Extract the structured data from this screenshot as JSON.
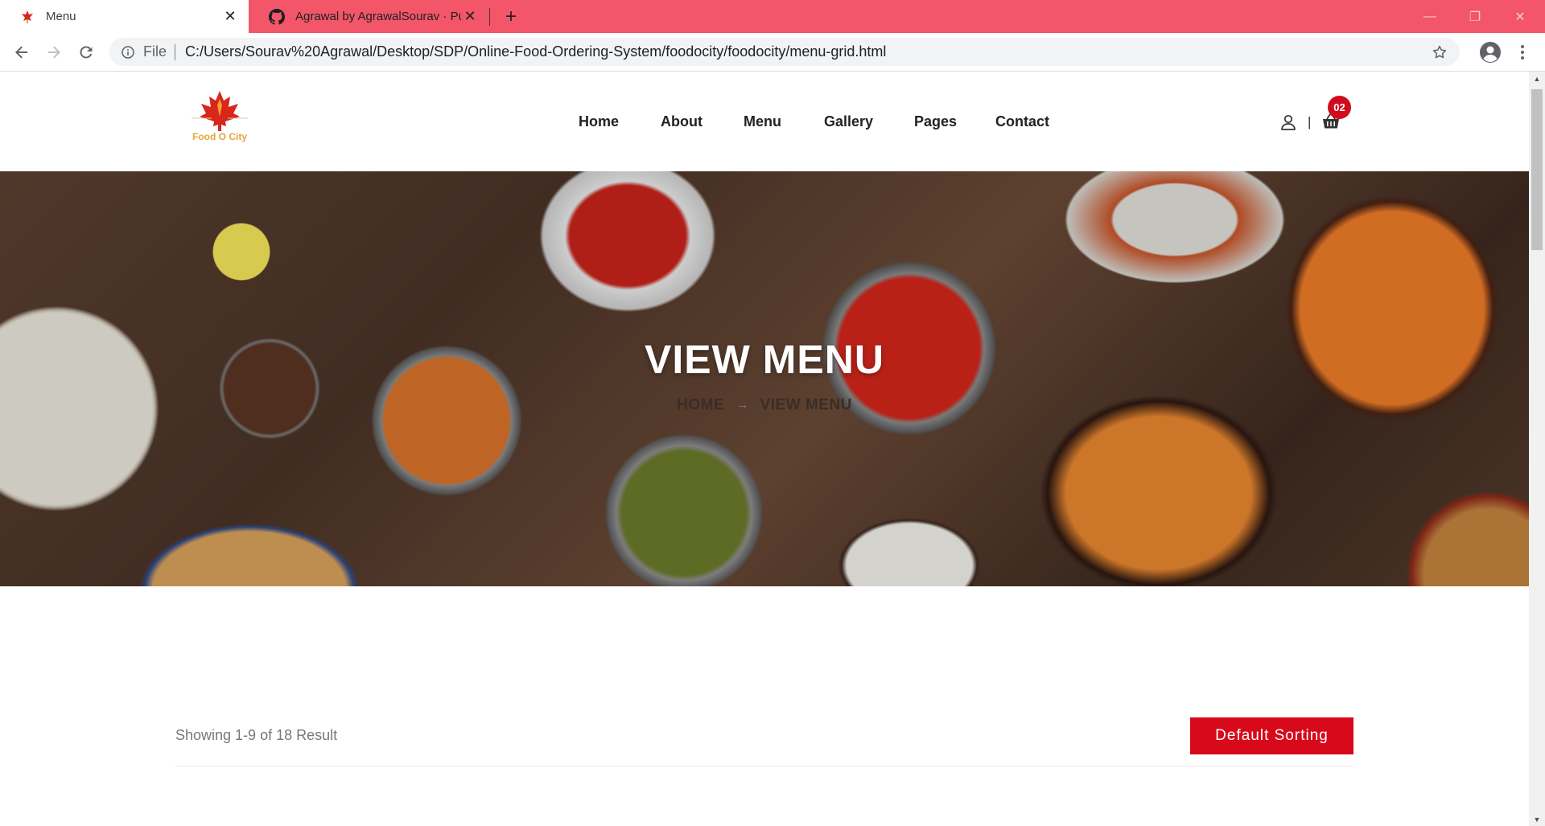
{
  "browser": {
    "tabs": [
      {
        "title": "Menu",
        "active": true
      },
      {
        "title": "Agrawal by AgrawalSourav · Pull",
        "active": false
      }
    ],
    "address": {
      "scheme_label": "File",
      "url": "C:/Users/Sourav%20Agrawal/Desktop/SDP/Online-Food-Ordering-System/foodocity/foodocity/menu-grid.html"
    },
    "colors": {
      "tabbar": "#f25668"
    }
  },
  "site": {
    "brand": "Food O City",
    "nav": [
      "Home",
      "About",
      "Menu",
      "Gallery",
      "Pages",
      "Contact"
    ],
    "cart_count": "02",
    "header_separator": "|",
    "accent": "#d7091a"
  },
  "hero": {
    "title": "VIEW MENU",
    "breadcrumb": [
      "HOME",
      "VIEW MENU"
    ],
    "breadcrumb_separator": "→"
  },
  "listing": {
    "result_text": "Showing 1-9 of 18 Result",
    "sort_label": "Default Sorting"
  }
}
